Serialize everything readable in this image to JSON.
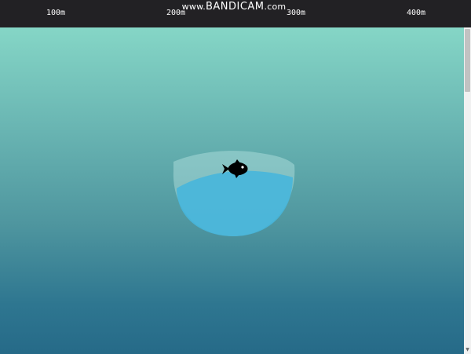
{
  "depth_bar": {
    "marks": [
      "100m",
      "200m",
      "300m",
      "400m"
    ]
  },
  "watermark": {
    "prefix": "www.",
    "brand": "BANDICAM",
    "suffix": ".com"
  },
  "scrollbar": {
    "up_arrow": "▲",
    "down_arrow": "▼",
    "scroll_position": 0
  },
  "icons": {
    "fish": "fish-icon",
    "bowl": "fishbowl-icon"
  },
  "colors": {
    "bar": "#222124",
    "ocean_top": "#85d6c6",
    "ocean_bottom": "#266a88",
    "bowl_water": "#47b6dc",
    "fish": "#000000"
  }
}
